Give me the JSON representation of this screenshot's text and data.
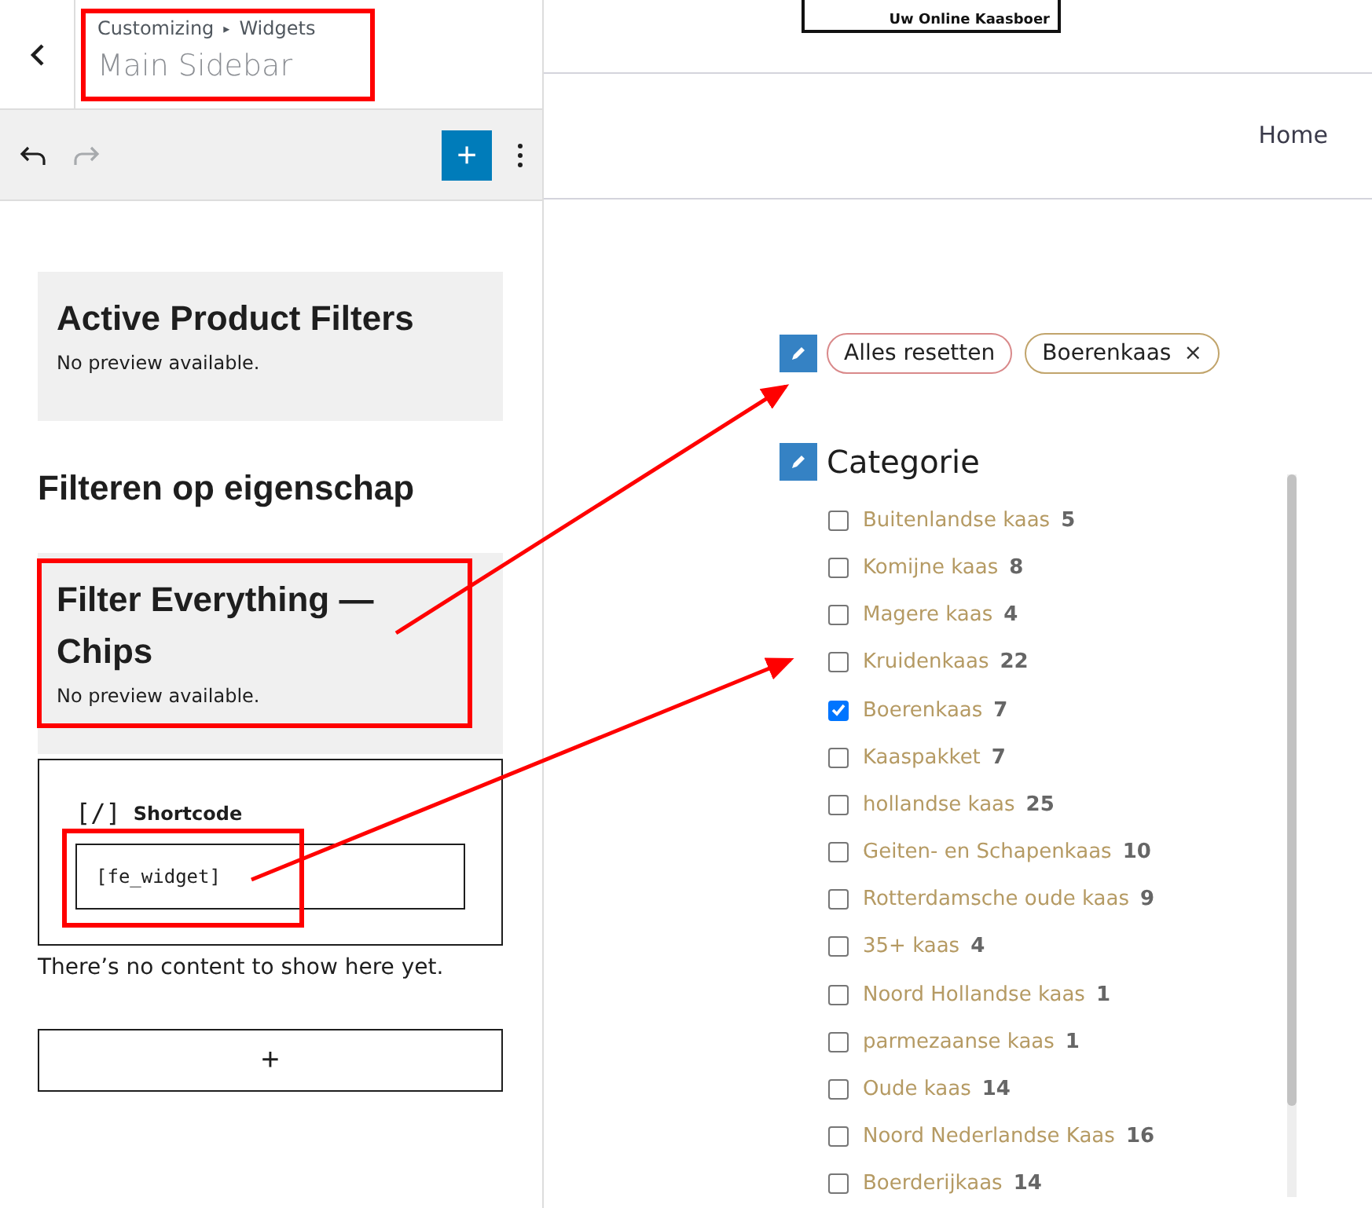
{
  "customizer": {
    "breadcrumb": [
      "Customizing",
      "Widgets"
    ],
    "breadcrumb_separator": "▸",
    "title": "Main Sidebar",
    "toolbar": {
      "undo_disabled": false,
      "redo_disabled": true,
      "add_label": "+"
    },
    "widgets": [
      {
        "kind": "preview",
        "title": "Active Product Filters",
        "note": "No preview available."
      },
      {
        "kind": "heading",
        "title": "Filteren op eigenschap"
      },
      {
        "kind": "preview",
        "title": "Filter Everything — Chips",
        "note": "No preview available."
      },
      {
        "kind": "shortcode",
        "label": "Shortcode",
        "icon_text": "[/]",
        "value": "[fe_widget]"
      }
    ],
    "empty_text": "There’s no content to show here yet.",
    "append_label": "+"
  },
  "site": {
    "logo_tagline": "Uw Online Kaasboer",
    "nav": [
      "Home"
    ],
    "chips": [
      {
        "label": "Alles resetten",
        "removable": false,
        "color": "#d9898a"
      },
      {
        "label": "Boerenkaas",
        "removable": true,
        "color": "#c1a46b"
      }
    ],
    "remove_symbol": "×",
    "category": {
      "title": "Categorie",
      "items": [
        {
          "label": "Buitenlandse kaas",
          "count": "5",
          "checked": false
        },
        {
          "label": "Komijne kaas",
          "count": "8",
          "checked": false
        },
        {
          "label": "Magere kaas",
          "count": "4",
          "checked": false
        },
        {
          "label": "Kruidenkaas",
          "count": "22",
          "checked": false
        },
        {
          "label": "Boerenkaas",
          "count": "7",
          "checked": true
        },
        {
          "label": "Kaaspakket",
          "count": "7",
          "checked": false
        },
        {
          "label": "hollandse kaas",
          "count": "25",
          "checked": false
        },
        {
          "label": "Geiten- en Schapenkaas",
          "count": "10",
          "checked": false
        },
        {
          "label": "Rotterdamsche oude kaas",
          "count": "9",
          "checked": false
        },
        {
          "label": "35+ kaas",
          "count": "4",
          "checked": false
        },
        {
          "label": "Noord Hollandse kaas",
          "count": "1",
          "checked": false
        },
        {
          "label": "parmezaanse kaas",
          "count": "1",
          "checked": false
        },
        {
          "label": "Oude kaas",
          "count": "14",
          "checked": false
        },
        {
          "label": "Noord Nederlandse Kaas",
          "count": "16",
          "checked": false
        },
        {
          "label": "Boerderijkaas",
          "count": "14",
          "checked": false
        }
      ]
    }
  }
}
